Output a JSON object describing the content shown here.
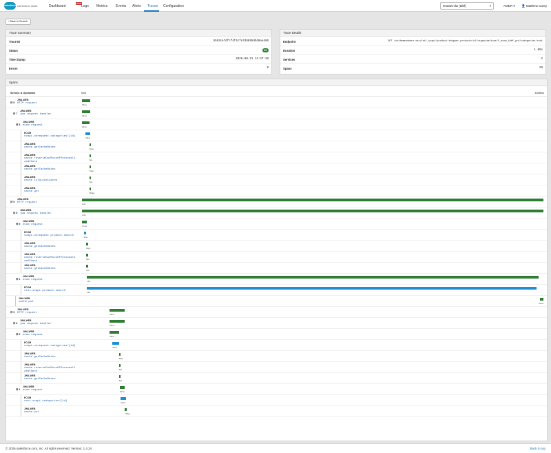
{
  "header": {
    "logo_text": "salesforce",
    "logo_sub": "commerce cloud",
    "nav": [
      "Dashboard",
      "Logs",
      "Metrics",
      "Events",
      "Alerts",
      "Traces",
      "Configuration"
    ],
    "new_badge": "NEW",
    "active_nav": "Traces",
    "instance_select": "test320-dw (tbbf)",
    "region": "AMER",
    "user": "Matthew Carey"
  },
  "back_button": "Back to Search",
  "trace_summary": {
    "title": "Trace Summary",
    "rows": [
      {
        "key": "Trace ID",
        "value": "b583ce7dfcf4f4cfe7d6895d5d8ae486"
      },
      {
        "key": "Status",
        "value": "OK"
      },
      {
        "key": "Time Stamp",
        "value": "2026-08-21 13:47:38"
      },
      {
        "key": "Errors",
        "value": "0"
      }
    ]
  },
  "trace_details": {
    "title": "Trace Details",
    "rows": [
      {
        "key": "Endpoint",
        "value": "GET /on/demandware.servlet/_scapi/product/shopper-products/v1/organizations/f_ecom_tbbf_prd/categories/root"
      },
      {
        "key": "Duration",
        "value": "1.85s"
      },
      {
        "key": "Services",
        "value": "2"
      },
      {
        "key": "Spans",
        "value": "29"
      }
    ]
  },
  "spans": {
    "title": "Spans",
    "col_service": "Service & Operation",
    "scale_start": "0ms",
    "scale_end": "1848ms",
    "status_colors": {
      "ok": "#2e7d32",
      "ecom": "#1f8fcf"
    },
    "rows": [
      {
        "toggle": "⊟ 9",
        "svc": "JWA-WEB",
        "op": "HTTP request",
        "start": 0.0,
        "width": 0.018,
        "dur": "36ms",
        "kind": "ok",
        "depth": 0
      },
      {
        "toggle": "⊟ 7",
        "svc": "JWA-WEB",
        "op": "jwa request handler",
        "start": 0.0,
        "width": 0.018,
        "dur": "34ms",
        "kind": "ok",
        "depth": 1
      },
      {
        "toggle": "⊟ 5",
        "svc": "JWA-WEB",
        "op": "ecom request",
        "start": 0.0,
        "width": 0.017,
        "dur": "33ms",
        "kind": "ok",
        "depth": 2
      },
      {
        "toggle": "",
        "svc": "ECOM",
        "op": "scapi.onrequest categories/{id}",
        "start": 0.008,
        "width": 0.01,
        "dur": "20ms",
        "kind": "ecom",
        "depth": 3
      },
      {
        "toggle": "",
        "svc": "JWA-WEB",
        "op": "cache getCacheDates",
        "start": 0.016,
        "width": 0.003,
        "dur": "94µs",
        "kind": "ok",
        "depth": 3
      },
      {
        "toggle": "",
        "svc": "JWA-WEB",
        "op": "cache reverseOutMissOfPersonalizedCheck",
        "start": 0.016,
        "width": 0.003,
        "dur": "8µs",
        "kind": "ok",
        "depth": 3,
        "wrap": true
      },
      {
        "toggle": "",
        "svc": "JWA-WEB",
        "op": "cache getCacheDates",
        "start": 0.016,
        "width": 0.003,
        "dur": "79µs",
        "kind": "ok",
        "depth": 3
      },
      {
        "toggle": "",
        "svc": "JWA-WEB",
        "op": "cache isInLocalCache",
        "start": 0.016,
        "width": 0.003,
        "dur": "5µs",
        "kind": "ok",
        "depth": 3
      },
      {
        "toggle": "",
        "svc": "JWA-WEB",
        "op": "cache get",
        "start": 0.016,
        "width": 0.003,
        "dur": "850µs",
        "kind": "ok",
        "depth": 3
      },
      {
        "toggle": "⊟ 9",
        "svc": "JWA-WEB",
        "op": "HTTP request",
        "start": 0.0,
        "width": 1.0,
        "dur": "1.8s",
        "kind": "ok",
        "depth": 0
      },
      {
        "toggle": "⊟ 8",
        "svc": "JWA-WEB",
        "op": "jwa request handler",
        "start": 0.0,
        "width": 1.0,
        "dur": "1.8s",
        "kind": "ok",
        "depth": 1
      },
      {
        "toggle": "⊟ 5",
        "svc": "JWA-WEB",
        "op": "ecom request",
        "start": 0.0,
        "width": 0.01,
        "dur": "17ms",
        "kind": "ok",
        "depth": 2
      },
      {
        "toggle": "",
        "svc": "ECOM",
        "op": "scapi.onrequest product-search",
        "start": 0.004,
        "width": 0.005,
        "dur": "9ms",
        "kind": "ecom",
        "depth": 3
      },
      {
        "toggle": "",
        "svc": "JWA-WEB",
        "op": "cache getCacheDates",
        "start": 0.009,
        "width": 0.003,
        "dur": "41µs",
        "kind": "ok",
        "depth": 3
      },
      {
        "toggle": "",
        "svc": "JWA-WEB",
        "op": "cache reverseOutMissOfPersonalizedCheck",
        "start": 0.009,
        "width": 0.003,
        "dur": "5µs",
        "kind": "ok",
        "depth": 3,
        "wrap": true
      },
      {
        "toggle": "",
        "svc": "JWA-WEB",
        "op": "cache getCacheDates",
        "start": 0.009,
        "width": 0.003,
        "dur": "7µs",
        "kind": "ok",
        "depth": 3
      },
      {
        "toggle": "⊟ 1",
        "svc": "JWA-WEB",
        "op": "ecom request",
        "start": 0.01,
        "width": 0.98,
        "dur": "1.8s",
        "kind": "ok",
        "depth": 2
      },
      {
        "toggle": "",
        "svc": "ECOM",
        "op": "rest.scapi product-search",
        "start": 0.01,
        "width": 0.975,
        "dur": "1.8s",
        "kind": "ecom",
        "depth": 3
      },
      {
        "toggle": "",
        "svc": "JWA-WEB",
        "op": "cache put",
        "start": 0.993,
        "width": 0.007,
        "dur": "33ms",
        "kind": "ok",
        "depth": 1
      },
      {
        "toggle": "⊟ 9",
        "svc": "JWA-WEB",
        "op": "HTTP request",
        "start": 0.06,
        "width": 0.033,
        "dur": "60ms",
        "kind": "ok",
        "depth": 0
      },
      {
        "toggle": "⊟ 8",
        "svc": "JWA-WEB",
        "op": "jwa request handler",
        "start": 0.06,
        "width": 0.033,
        "dur": "60ms",
        "kind": "ok",
        "depth": 1
      },
      {
        "toggle": "⊟ 5",
        "svc": "JWA-WEB",
        "op": "ecom request",
        "start": 0.06,
        "width": 0.021,
        "dur": "39ms",
        "kind": "ok",
        "depth": 2
      },
      {
        "toggle": "",
        "svc": "ECOM",
        "op": "scapi.onrequest categories/{id}",
        "start": 0.066,
        "width": 0.015,
        "dur": "28ms",
        "kind": "ecom",
        "depth": 3
      },
      {
        "toggle": "",
        "svc": "JWA-WEB",
        "op": "cache getCacheDates",
        "start": 0.08,
        "width": 0.003,
        "dur": "28µs",
        "kind": "ok",
        "depth": 3
      },
      {
        "toggle": "",
        "svc": "JWA-WEB",
        "op": "cache reverseOutMissOfPersonalizedCheck",
        "start": 0.08,
        "width": 0.003,
        "dur": "5µs",
        "kind": "ok",
        "depth": 3,
        "wrap": true
      },
      {
        "toggle": "",
        "svc": "JWA-WEB",
        "op": "cache getCacheDates",
        "start": 0.08,
        "width": 0.003,
        "dur": "9µs",
        "kind": "ok",
        "depth": 3
      },
      {
        "toggle": "⊟ 1",
        "svc": "JWA-WEB",
        "op": "ecom request",
        "start": 0.082,
        "width": 0.011,
        "dur": "19ms",
        "kind": "ok",
        "depth": 2
      },
      {
        "toggle": "",
        "svc": "ECOM",
        "op": "rest.scapi categories/{id}",
        "start": 0.084,
        "width": 0.011,
        "dur": "22ms",
        "kind": "ecom",
        "depth": 3
      },
      {
        "toggle": "",
        "svc": "JWA-WEB",
        "op": "cache put",
        "start": 0.093,
        "width": 0.003,
        "dur": "749µs",
        "kind": "ok",
        "depth": 3
      }
    ]
  },
  "footer": {
    "copyright": "© 2026 salesforce.com, inc. All rights reserved. Version: 1.4.24",
    "back_to_top": "Back to top"
  }
}
